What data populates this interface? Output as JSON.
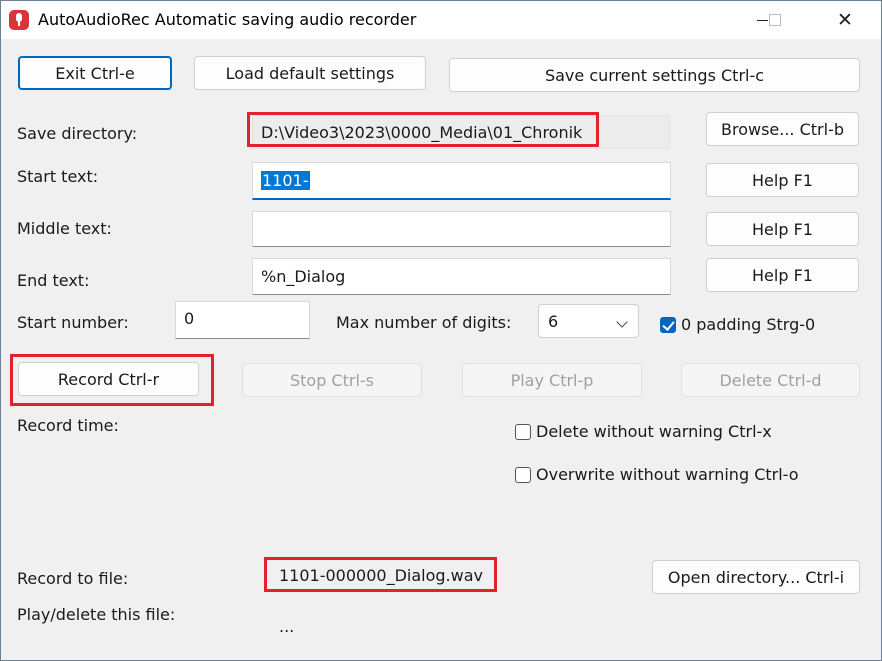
{
  "window": {
    "title": "AutoAudioRec Automatic saving audio recorder",
    "close_glyph": "✕"
  },
  "toolbar": {
    "exit_label": "Exit Ctrl-e",
    "load_defaults_label": "Load default settings",
    "save_settings_label": "Save current settings Ctrl-c"
  },
  "save_dir": {
    "label": "Save directory:",
    "value": "D:\\Video3\\2023\\0000_Media\\01_Chronik",
    "browse_label": "Browse... Ctrl-b"
  },
  "start_text": {
    "label": "Start text:",
    "value": "1101-",
    "help_label": "Help F1"
  },
  "middle_text": {
    "label": "Middle text:",
    "value": "",
    "help_label": "Help F1"
  },
  "end_text": {
    "label": "End text:",
    "value": "%n_Dialog",
    "help_label": "Help F1"
  },
  "number": {
    "start_label": "Start number:",
    "start_value": "0",
    "max_digits_label": "Max number of digits:",
    "max_digits_value": "6",
    "padding_label": "0 padding Strg-0",
    "padding_checked": true
  },
  "controls": {
    "record_label": "Record Ctrl-r",
    "stop_label": "Stop Ctrl-s",
    "play_label": "Play Ctrl-p",
    "delete_label": "Delete Ctrl-d"
  },
  "record_time_label": "Record time:",
  "options": {
    "delete_no_warn_label": "Delete without warning Ctrl-x",
    "delete_no_warn_checked": false,
    "overwrite_no_warn_label": "Overwrite without warning Ctrl-o",
    "overwrite_no_warn_checked": false
  },
  "record_file": {
    "label": "Record to file:",
    "value": "1101-000000_Dialog.wav",
    "open_dir_label": "Open directory... Ctrl-i"
  },
  "play_file": {
    "label": "Play/delete this file:",
    "value": "..."
  },
  "colors": {
    "highlight": "#e3232b",
    "accent": "#0067c0",
    "app_icon": "#d9343a"
  }
}
